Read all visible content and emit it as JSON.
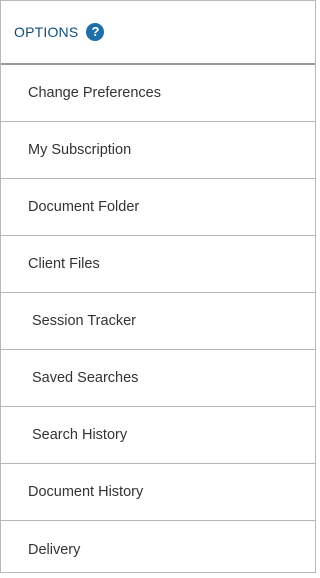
{
  "header": {
    "title": "OPTIONS",
    "help_icon": "help-icon",
    "help_glyph": "?",
    "accent_color": "#1e6fa8"
  },
  "menu": {
    "items": [
      {
        "label": "Change Preferences"
      },
      {
        "label": "My Subscription"
      },
      {
        "label": "Document Folder"
      },
      {
        "label": "Client Files"
      },
      {
        "label": "Session Tracker"
      },
      {
        "label": "Saved Searches"
      },
      {
        "label": "Search History"
      },
      {
        "label": "Document History"
      },
      {
        "label": "Delivery"
      }
    ]
  }
}
